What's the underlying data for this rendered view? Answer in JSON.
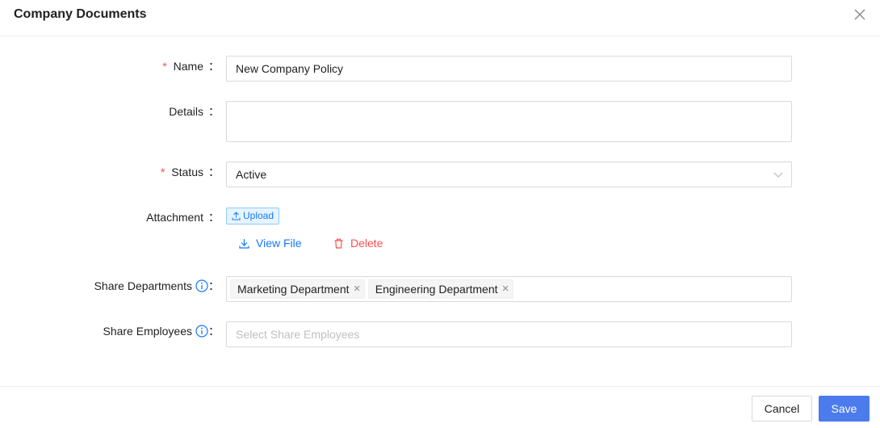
{
  "dialog": {
    "title": "Company Documents"
  },
  "form": {
    "name": {
      "label": "Name",
      "value": "New Company Policy"
    },
    "details": {
      "label": "Details",
      "value": ""
    },
    "status": {
      "label": "Status",
      "value": "Active"
    },
    "attachment": {
      "label": "Attachment",
      "upload_label": "Upload",
      "view_label": "View File",
      "delete_label": "Delete"
    },
    "share_departments": {
      "label": "Share Departments",
      "tags": [
        "Marketing Department",
        "Engineering Department"
      ]
    },
    "share_employees": {
      "label": "Share Employees",
      "placeholder": "Select Share Employees"
    },
    "colon": "："
  },
  "footer": {
    "cancel_label": "Cancel",
    "save_label": "Save"
  },
  "colors": {
    "primary": "#4b7bec",
    "link": "#1677ff",
    "danger": "#ff4d4f"
  },
  "icons": {
    "close": "close-icon",
    "chevron": "chevron-down-icon",
    "upload": "upload-icon",
    "download": "download-icon",
    "delete": "trash-icon",
    "info": "info-circle-icon"
  }
}
